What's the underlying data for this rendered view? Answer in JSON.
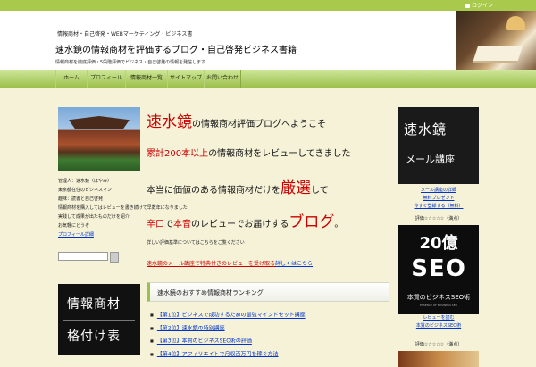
{
  "topbar": {
    "login_label": "ログイン"
  },
  "header": {
    "tagline": "情報商材・自己啓発・WEBマーケティング・ビジネス書",
    "title": "速水鏡の情報商材を評価するブログ・自己啓発ビジネス書籍",
    "description": "情報商材を徹底評価・5段階評価でビジネス・自己啓発の情報を発信します"
  },
  "nav": {
    "items": [
      "ホーム",
      "プロフィール",
      "情報商材一覧",
      "サイトマップ",
      "お問い合わせ"
    ]
  },
  "left": {
    "lines": [
      "管理人：速水鏡（はやみ）",
      "東京都在住のビジネスマン",
      "趣味：読書と自己啓発",
      "情報商材を購入してはレビューを書き続けて早数年になりました",
      "実践して成果が出たものだけを紹介",
      "お気軽にどうぞ"
    ],
    "profile_link": "プロフィール詳細",
    "search_placeholder": "",
    "banner_line1": "情報商材",
    "banner_line2": "格付け表"
  },
  "center": {
    "headline1": {
      "red": "速水鏡",
      "rest": "の情報商材評価ブログへようこそ"
    },
    "headline2": {
      "red1": "累計",
      "red2": "200",
      "red3": "本以上",
      "rest": "の情報商材をレビューしてきました"
    },
    "headline3": {
      "pre": "本当に価値のある情報商材だけを",
      "red": "厳選",
      "post": "して"
    },
    "headline4": {
      "red1": "辛口",
      "mid1": "で",
      "red2": "本音",
      "mid2": "のレビューでお届けする",
      "red3": "ブログ",
      "post": "。"
    },
    "small_text": "詳しい評価基準についてはこちらをご覧ください",
    "mixed": {
      "red": "速水鏡のメール講座で特典付きのレビューを受け取る",
      "blue": "詳しくはこちら"
    },
    "box_title": "速水鏡のおすすめ情報商材ランキング",
    "list": [
      "【第1位】ビジネスで成功するための最強マインドセット講座",
      "【第2位】速水鏡の特別講座",
      "【第3位】本質のビジネスSEO術の評価",
      "【第4位】アフィリエイトで月収百万円を稼ぐ方法"
    ]
  },
  "right": {
    "banner1_line1": "速水鏡",
    "banner1_line2": "メール講座",
    "links1": [
      "メール講座の詳細",
      "無料プレゼント",
      "今すぐ登録する（無料）"
    ],
    "rating1": "評価☆☆☆☆☆（満点）",
    "banner2_line1": "20億",
    "banner2_line2": "SEO",
    "banner2_line3": "本質のビジネスSEO術",
    "banner2_line4": "ESSENCE OF BUSINESS SEO",
    "links2": [
      "レビューを読む",
      "本質のビジネスSEO術"
    ],
    "rating2": "評価☆☆☆☆☆（満点）"
  }
}
